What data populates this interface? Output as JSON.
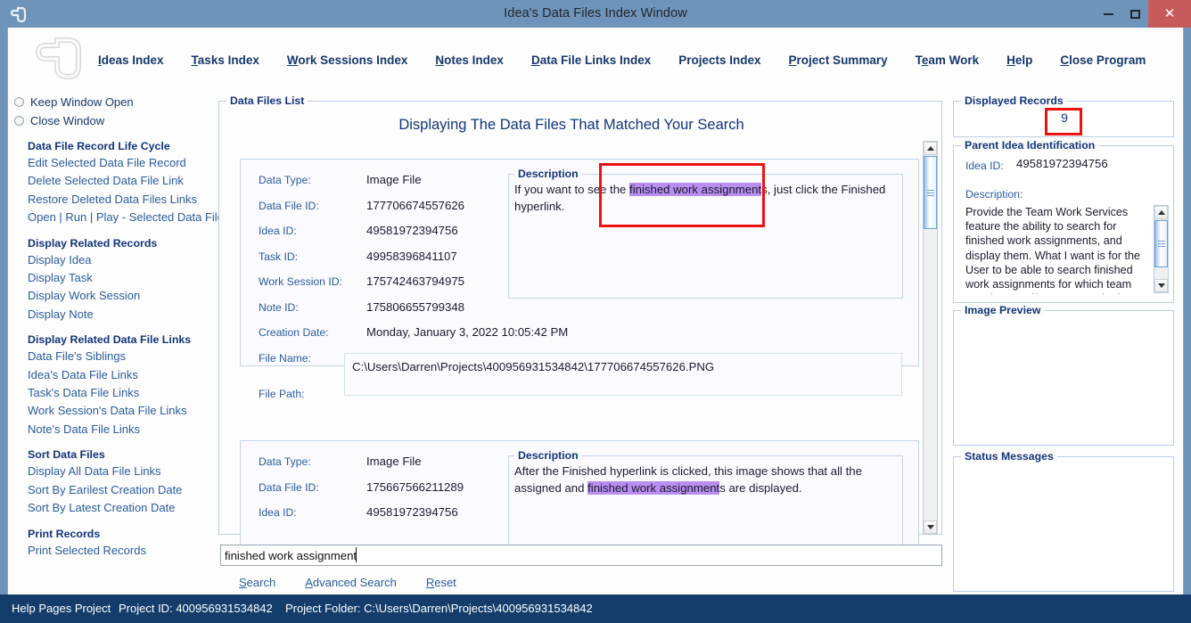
{
  "window": {
    "title": "Idea's Data Files Index Window",
    "app_icon": "app-logo-icon",
    "minimize_label": "—",
    "maximize_label": "□",
    "close_label": "✕",
    "close_color": "#c75b5b",
    "titlebar_color": "#6f94ba"
  },
  "menu": {
    "items": [
      {
        "label": "Ideas Index",
        "accel": "I"
      },
      {
        "label": "Tasks Index",
        "accel": "T"
      },
      {
        "label": "Work Sessions Index",
        "accel": "W"
      },
      {
        "label": "Notes Index",
        "accel": "N"
      },
      {
        "label": "Data File Links Index",
        "accel": "D"
      },
      {
        "label": "Projects Index",
        "accel": ""
      },
      {
        "label": "Project Summary",
        "accel": "P"
      },
      {
        "label": "Team Work",
        "accel": "e"
      },
      {
        "label": "Help",
        "accel": "H"
      },
      {
        "label": "Close Program",
        "accel": "C"
      }
    ]
  },
  "sidebar": {
    "radios": [
      {
        "label": "Keep Window Open",
        "selected": false
      },
      {
        "label": "Close Window",
        "selected": false
      }
    ],
    "sections": [
      {
        "heading": "Data File Record Life Cycle",
        "links": [
          "Edit Selected Data File Record",
          "Delete Selected Data File Link",
          "Restore Deleted Data Files Links",
          "Open | Run | Play - Selected Data File"
        ]
      },
      {
        "heading": "Display Related Records",
        "links": [
          "Display Idea",
          "Display Task",
          "Display Work Session",
          "Display Note"
        ]
      },
      {
        "heading": "Display Related Data File Links",
        "links": [
          "Data File's Siblings",
          "Idea's Data File Links",
          "Task's Data File Links",
          "Work Session's Data File Links",
          "Note's Data File Links"
        ]
      },
      {
        "heading": "Sort Data Files",
        "links": [
          "Display All Data File Links",
          "Sort By Earilest Creation Date",
          "Sort By Latest Creation Date"
        ]
      },
      {
        "heading": "Print Records",
        "links": [
          "Print Selected Records"
        ]
      }
    ]
  },
  "data_files_list": {
    "legend": "Data Files List",
    "title": "Displaying The Data Files That Matched Your Search",
    "records": [
      {
        "labels": {
          "data_type": "Data Type:",
          "data_file_id": "Data File ID:",
          "idea_id": "Idea ID:",
          "task_id": "Task ID:",
          "work_session_id": "Work Session ID:",
          "note_id": "Note ID:",
          "creation_date": "Creation Date:",
          "file_name": "File Name:",
          "file_path": "File Path:"
        },
        "values": {
          "data_type": "Image File",
          "data_file_id": "177706674557626",
          "idea_id": "49581972394756",
          "task_id": "49958396841107",
          "work_session_id": "175742463794975",
          "note_id": "175806655799348",
          "creation_date": "Monday, January 3, 2022   10:05:42 PM",
          "file_name": "177706674557626.PNG",
          "file_path": "C:\\Users\\Darren\\Projects\\400956931534842\\177706674557626.PNG"
        },
        "description": {
          "legend": "Description",
          "pre": "If you want to see the ",
          "highlight": "finished work assignment",
          "post": "s, just click the Finished hyperlink."
        }
      },
      {
        "labels": {
          "data_type": "Data Type:",
          "data_file_id": "Data File ID:",
          "idea_id": "Idea ID:"
        },
        "values": {
          "data_type": "Image File",
          "data_file_id": "175667566211289",
          "idea_id": "49581972394756"
        },
        "description": {
          "legend": "Description",
          "pre": "After the Finished hyperlink is clicked, this image shows that all the assigned and ",
          "highlight": "finished work assignment",
          "post": "s are displayed."
        }
      }
    ]
  },
  "search": {
    "value": "finished work assignment",
    "placeholder": "",
    "actions": [
      {
        "label": "Search",
        "accel": "S"
      },
      {
        "label": "Advanced Search",
        "accel": "A"
      },
      {
        "label": "Reset",
        "accel": "R"
      }
    ]
  },
  "right_panel": {
    "displayed_records": {
      "legend": "Displayed Records",
      "count": "9",
      "highlight_color": "#ee1111"
    },
    "parent_idea": {
      "legend": "Parent Idea Identification",
      "idea_id_label": "Idea ID:",
      "idea_id_value": "49581972394756",
      "description_label": "Description:",
      "description_text": "Provide the Team Work Services feature the ability to search for finished work assignments, and display them. What I want is for the User to be able to search finished work assignments for which team members and/or teams worked on them."
    },
    "image_preview": {
      "legend": "Image Preview"
    },
    "status_messages": {
      "legend": "Status Messages"
    }
  },
  "statusbar": {
    "project_name": "Help Pages Project",
    "project_id_label": "Project ID:",
    "project_id_value": "400956931534842",
    "project_folder_label": "Project Folder:",
    "project_folder_value": "C:\\Users\\Darren\\Projects\\400956931534842",
    "background": "#143d6b"
  }
}
